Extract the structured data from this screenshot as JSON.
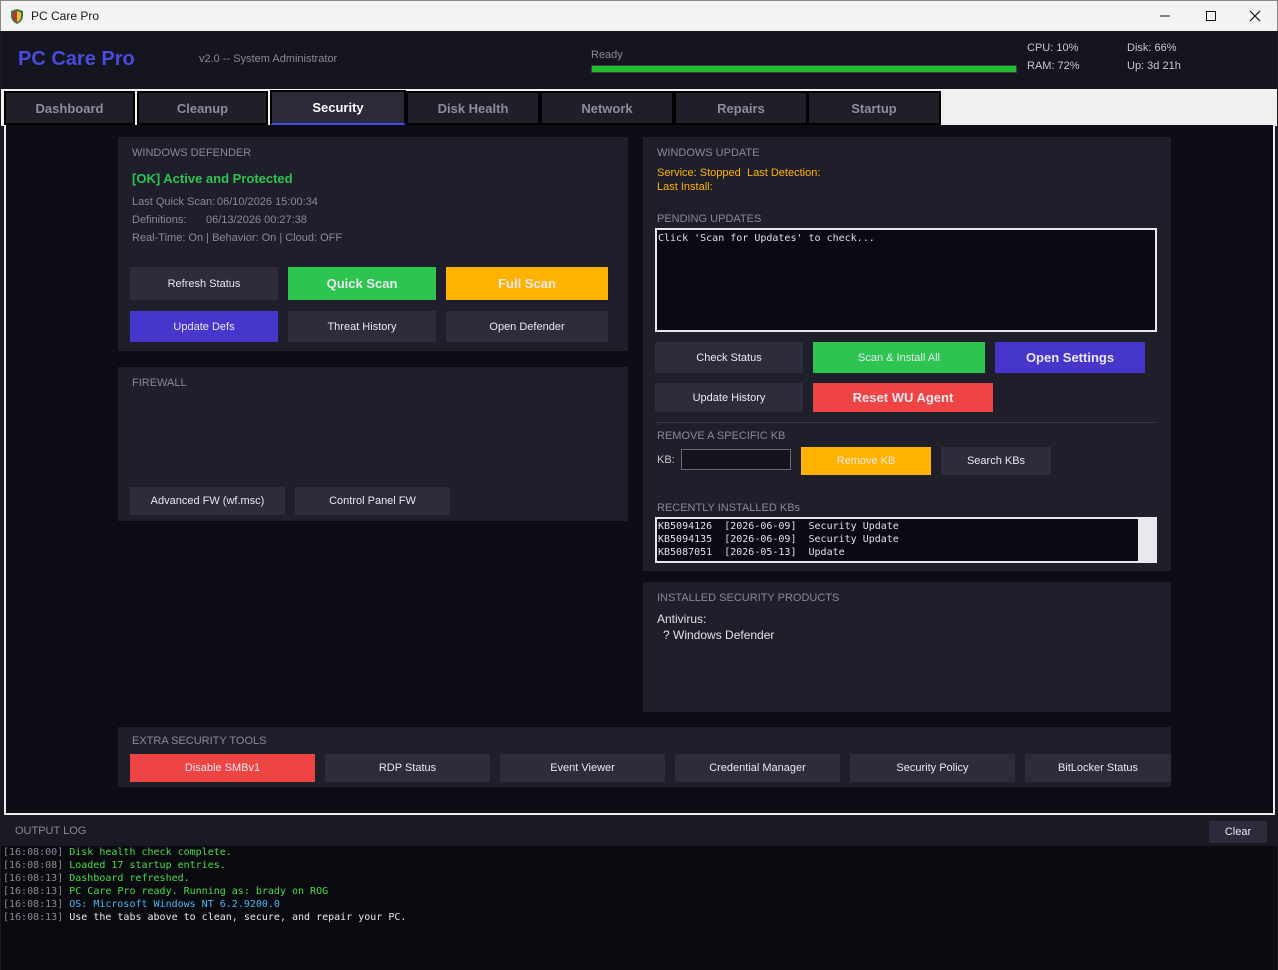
{
  "window": {
    "title": "PC Care Pro"
  },
  "header": {
    "brand": "PC Care Pro",
    "version": "v2.0  --  System Administrator",
    "status_label": "Ready",
    "progress": 1.0,
    "cpu": "CPU: 10%",
    "ram": "RAM: 72%",
    "disk": "Disk: 66%",
    "uptime": "Up: 3d 21h"
  },
  "tabs": [
    {
      "label": "Dashboard"
    },
    {
      "label": "Cleanup"
    },
    {
      "label": "Security"
    },
    {
      "label": "Disk Health"
    },
    {
      "label": "Network"
    },
    {
      "label": "Repairs"
    },
    {
      "label": "Startup"
    }
  ],
  "active_tab": "Security",
  "defender": {
    "title": "WINDOWS DEFENDER",
    "status": "[OK] Active and Protected",
    "last_scan_label": "Last Quick Scan:",
    "last_scan_value": "06/10/2026 15:00:34",
    "defs_label": "Definitions:",
    "defs_value": "06/13/2026 00:27:38",
    "realtime": "Real-Time: On  |  Behavior: On  |  Cloud: OFF",
    "buttons": {
      "refresh": "Refresh Status",
      "quick": "Quick Scan",
      "full": "Full Scan",
      "update_defs": "Update Defs",
      "threat_history": "Threat History",
      "open_defender": "Open Defender"
    }
  },
  "firewall": {
    "title": "FIREWALL",
    "buttons": {
      "advanced": "Advanced FW (wf.msc)",
      "control_panel": "Control Panel FW"
    }
  },
  "windows_update": {
    "title": "WINDOWS UPDATE",
    "service": "Service: Stopped",
    "last_detection": "Last Detection:",
    "last_install": "Last Install:",
    "pending_title": "PENDING UPDATES",
    "pending_text": "Click 'Scan for Updates' to check...",
    "buttons": {
      "check_status": "Check Status",
      "scan_install": "Scan & Install All",
      "open_settings": "Open Settings",
      "update_history": "Update History",
      "reset_agent": "Reset WU Agent"
    },
    "remove_title": "REMOVE A SPECIFIC KB",
    "kb_label": "KB:",
    "kb_value": "",
    "remove_btn": "Remove KB",
    "search_btn": "Search KBs",
    "recent_title": "RECENTLY INSTALLED KBs",
    "recent": [
      "KB5094126  [2026-06-09]  Security Update",
      "KB5094135  [2026-06-09]  Security Update",
      "KB5087051  [2026-05-13]  Update"
    ]
  },
  "products": {
    "title": "INSTALLED SECURITY PRODUCTS",
    "antivirus_label": "Antivirus:",
    "antivirus_item": "? Windows Defender"
  },
  "extra_tools": {
    "title": "EXTRA SECURITY TOOLS",
    "buttons": [
      "Disable SMBv1",
      "RDP Status",
      "Event Viewer",
      "Credential Manager",
      "Security Policy",
      "BitLocker Status"
    ]
  },
  "log": {
    "title": "OUTPUT LOG",
    "clear": "Clear",
    "lines": [
      {
        "time": "[16:08:00]",
        "text": "Disk health check complete.",
        "color": "#4ade4a"
      },
      {
        "time": "[16:08:08]",
        "text": "Loaded 17 startup entries.",
        "color": "#4ade4a"
      },
      {
        "time": "[16:08:13]",
        "text": "Dashboard refreshed.",
        "color": "#4ade4a"
      },
      {
        "time": "[16:08:13]",
        "text": "PC Care Pro ready. Running as: brady on ROG",
        "color": "#4ade4a"
      },
      {
        "time": "[16:08:13]",
        "text": "OS: Microsoft Windows NT 6.2.9200.0",
        "color": "#4ab8f0"
      },
      {
        "time": "[16:08:13]",
        "text": "Use the tabs above to clean, secure, and repair your PC.",
        "color": "#e8e8ee"
      }
    ]
  },
  "colors": {
    "accent": "#4a4ade",
    "ok": "#2ec450",
    "warn": "#ffb300",
    "danger": "#ef4444"
  }
}
